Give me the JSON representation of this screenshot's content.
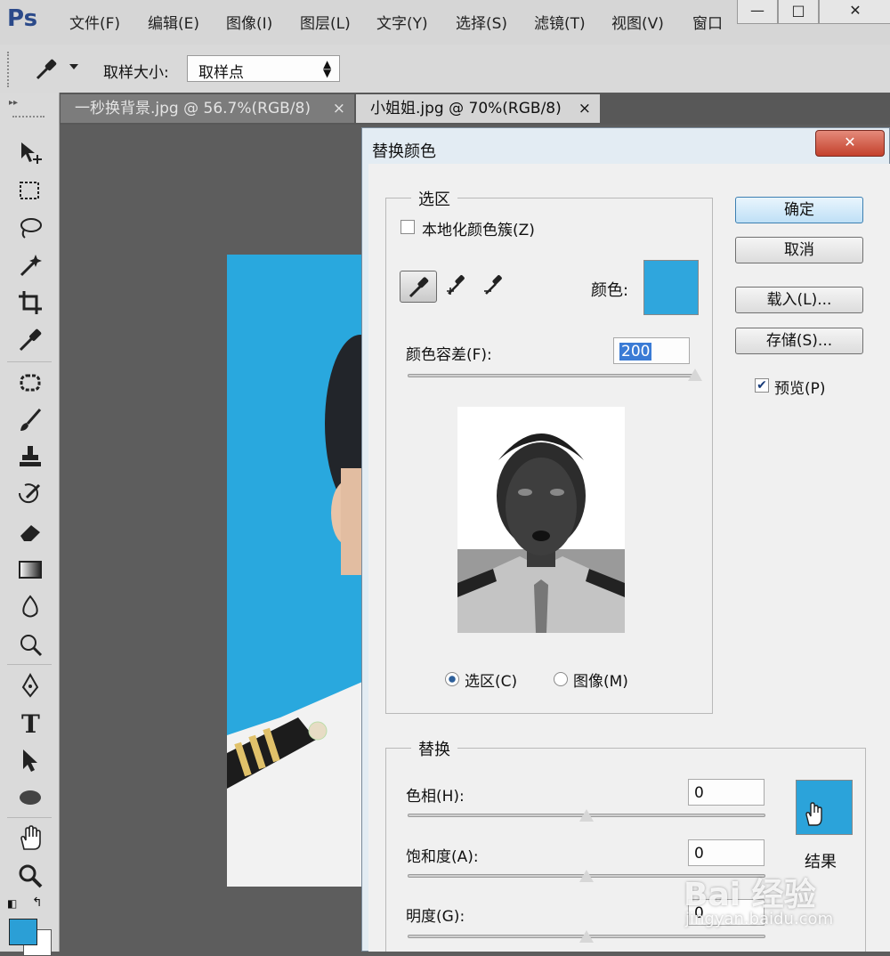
{
  "app": {
    "logo": "Ps"
  },
  "menu": [
    "文件(F)",
    "编辑(E)",
    "图像(I)",
    "图层(L)",
    "文字(Y)",
    "选择(S)",
    "滤镜(T)",
    "视图(V)",
    "窗口"
  ],
  "window_controls": {
    "minimize": "—",
    "maximize": "□",
    "close": "✕"
  },
  "options_bar": {
    "sample_size_label": "取样大小:",
    "sample_size_value": "取样点"
  },
  "tabs": [
    {
      "label": "一秒换背景.jpg @ 56.7%(RGB/8)",
      "close": "×",
      "active": false
    },
    {
      "label": "小姐姐.jpg @ 70%(RGB/8)",
      "close": "×",
      "active": true
    }
  ],
  "tools": [
    "move-icon",
    "marquee-icon",
    "lasso-icon",
    "magic-wand-icon",
    "crop-icon",
    "eyedropper-icon",
    "spot-heal-icon",
    "brush-icon",
    "stamp-icon",
    "history-brush-icon",
    "eraser-icon",
    "gradient-icon",
    "blur-icon",
    "dodge-icon",
    "pen-icon",
    "type-icon",
    "path-select-icon",
    "ellipse-icon",
    "hand-icon",
    "zoom-icon"
  ],
  "colors": {
    "foreground": "#2b9fd6",
    "background": "#ffffff",
    "result": "#2ba3da",
    "sample": "#2fa6dd"
  },
  "dialog": {
    "title": "替换颜色",
    "close": "✕",
    "selection": {
      "legend": "选区",
      "localized_label": "本地化颜色簇(Z)",
      "localized_checked": false,
      "color_label": "颜色:",
      "fuzziness_label": "颜色容差(F):",
      "fuzziness_value": "200",
      "fuzziness_fraction": 1.0,
      "radio_selection": "选区(C)",
      "radio_image": "图像(M)",
      "selected_radio": "selection"
    },
    "buttons": {
      "ok": "确定",
      "cancel": "取消",
      "load": "载入(L)...",
      "save": "存储(S)..."
    },
    "preview_label": "预览(P)",
    "preview_checked": true,
    "replacement": {
      "legend": "替换",
      "hue_label": "色相(H):",
      "hue_value": "0",
      "saturation_label": "饱和度(A):",
      "saturation_value": "0",
      "lightness_label": "明度(G):",
      "lightness_value": "0",
      "result_label": "结果"
    }
  },
  "watermark": {
    "brand": "Bai 经验",
    "url": "jingyan.baidu.com"
  }
}
